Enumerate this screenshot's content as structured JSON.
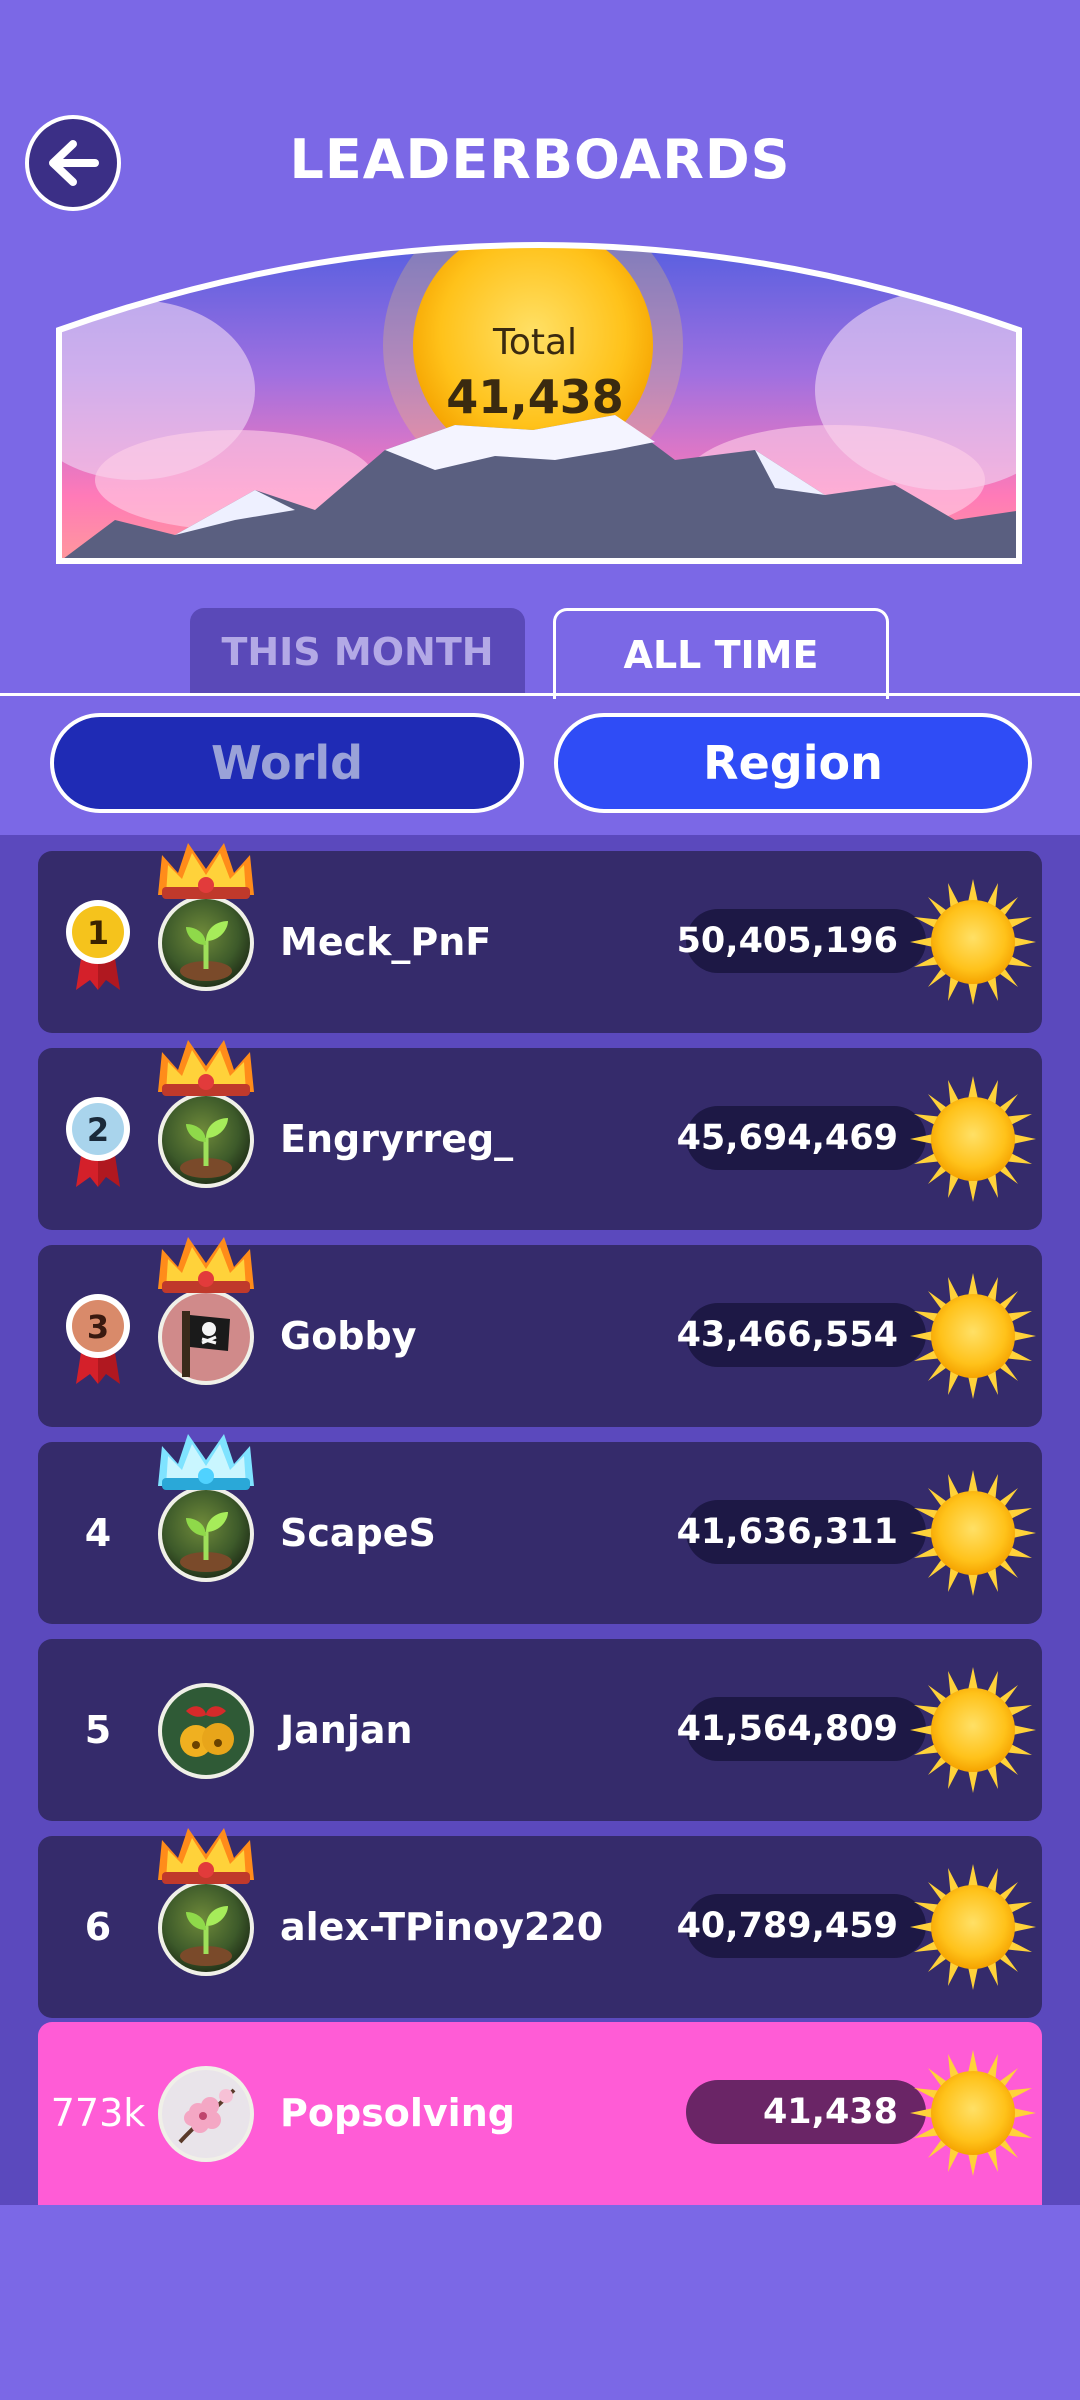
{
  "header": {
    "title": "LEADERBOARDS",
    "back_icon": "arrow-left-icon"
  },
  "banner": {
    "total_label": "Total",
    "total_value": "41,438"
  },
  "tabs": [
    {
      "label": "THIS MONTH",
      "selected": false
    },
    {
      "label": "ALL TIME",
      "selected": true
    }
  ],
  "segments": [
    {
      "label": "World",
      "selected": false
    },
    {
      "label": "Region",
      "selected": true
    }
  ],
  "rows": [
    {
      "rank": "1",
      "medal": "gold",
      "name": "Meck_PnF",
      "score": "50,405,196",
      "avatar": "sprout",
      "crown": "fire"
    },
    {
      "rank": "2",
      "medal": "silver",
      "name": "Engryrreg_",
      "score": "45,694,469",
      "avatar": "sprout",
      "crown": "fire"
    },
    {
      "rank": "3",
      "medal": "bronze",
      "name": "Gobby",
      "score": "43,466,554",
      "avatar": "pirate",
      "crown": "fire"
    },
    {
      "rank": "4",
      "medal": "",
      "name": "ScapeS",
      "score": "41,636,311",
      "avatar": "sprout",
      "crown": "ice"
    },
    {
      "rank": "5",
      "medal": "",
      "name": "Janjan",
      "score": "41,564,809",
      "avatar": "bells",
      "crown": ""
    },
    {
      "rank": "6",
      "medal": "",
      "name": "alex-TPinoy220",
      "score": "40,789,459",
      "avatar": "sprout",
      "crown": "fire"
    }
  ],
  "me": {
    "rank": "773k",
    "name": "Popsolving",
    "score": "41,438",
    "avatar": "blossom"
  },
  "colors": {
    "background": "#7b68e6",
    "row": "#352b6b",
    "me_row": "#ff5cd6",
    "region_button": "#2f4cf6",
    "world_button": "#1f2bb5"
  }
}
